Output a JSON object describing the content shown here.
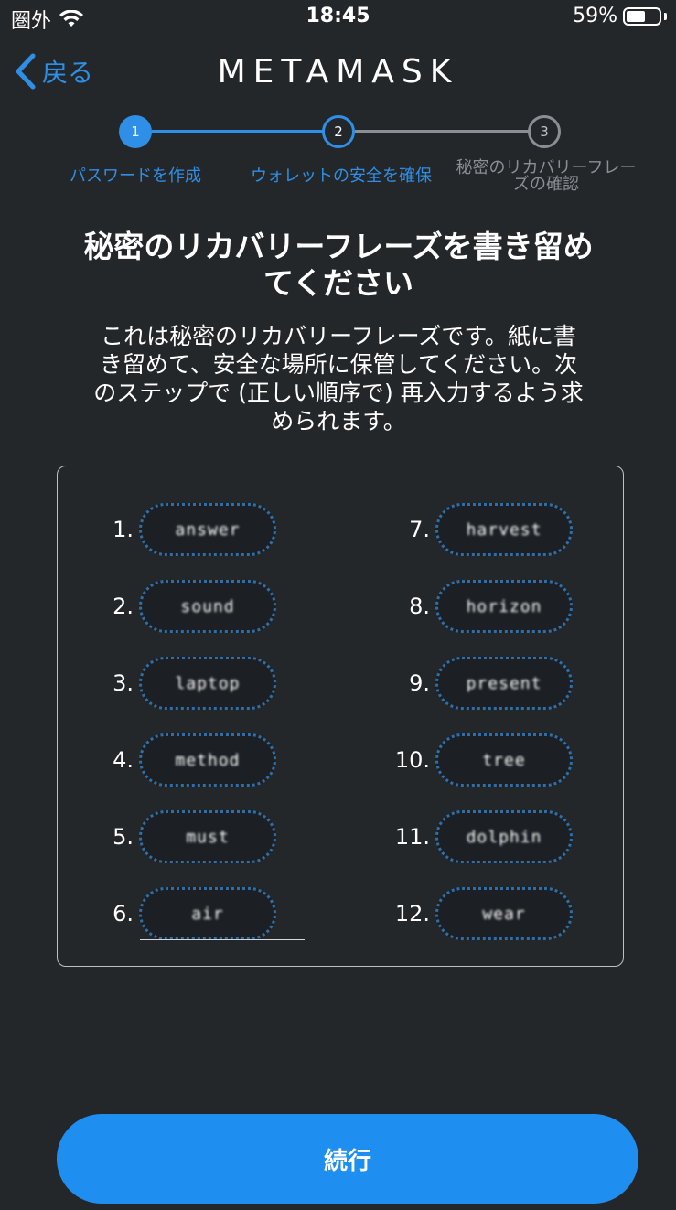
{
  "status_bar": {
    "carrier": "圏外",
    "time": "18:45",
    "battery_percent": "59%",
    "battery_level": 0.59
  },
  "header": {
    "back_label": "戻る",
    "brand": "METAMASK"
  },
  "stepper": {
    "steps": [
      {
        "number": "1",
        "label": "パスワードを作成",
        "state": "done"
      },
      {
        "number": "2",
        "label": "ウォレットの安全を確保",
        "state": "current"
      },
      {
        "number": "3",
        "label_line1": "秘密のリカバリーフレー",
        "label_line2": "ズの確認",
        "state": "upcoming"
      }
    ],
    "active_color": "#2f8fe6",
    "inactive_color": "#8a8f94"
  },
  "main": {
    "title_line1": "秘密のリカバリーフレーズを書き留め",
    "title_line2": "てください",
    "desc_line1": "これは秘密のリカバリーフレーズです。紙に書",
    "desc_line2": "き留めて、安全な場所に保管してください。次",
    "desc_line3": "のステップで (正しい順序で) 再入力するよう求",
    "desc_line4": "められます。"
  },
  "words": [
    {
      "number": "1.",
      "word": "answer"
    },
    {
      "number": "2.",
      "word": "sound"
    },
    {
      "number": "3.",
      "word": "laptop"
    },
    {
      "number": "4.",
      "word": "method"
    },
    {
      "number": "5.",
      "word": "must"
    },
    {
      "number": "6.",
      "word": "air"
    },
    {
      "number": "7.",
      "word": "harvest"
    },
    {
      "number": "8.",
      "word": "horizon"
    },
    {
      "number": "9.",
      "word": "present"
    },
    {
      "number": "10.",
      "word": "tree"
    },
    {
      "number": "11.",
      "word": "dolphin"
    },
    {
      "number": "12.",
      "word": "wear"
    }
  ],
  "footer": {
    "continue_label": "続行"
  }
}
